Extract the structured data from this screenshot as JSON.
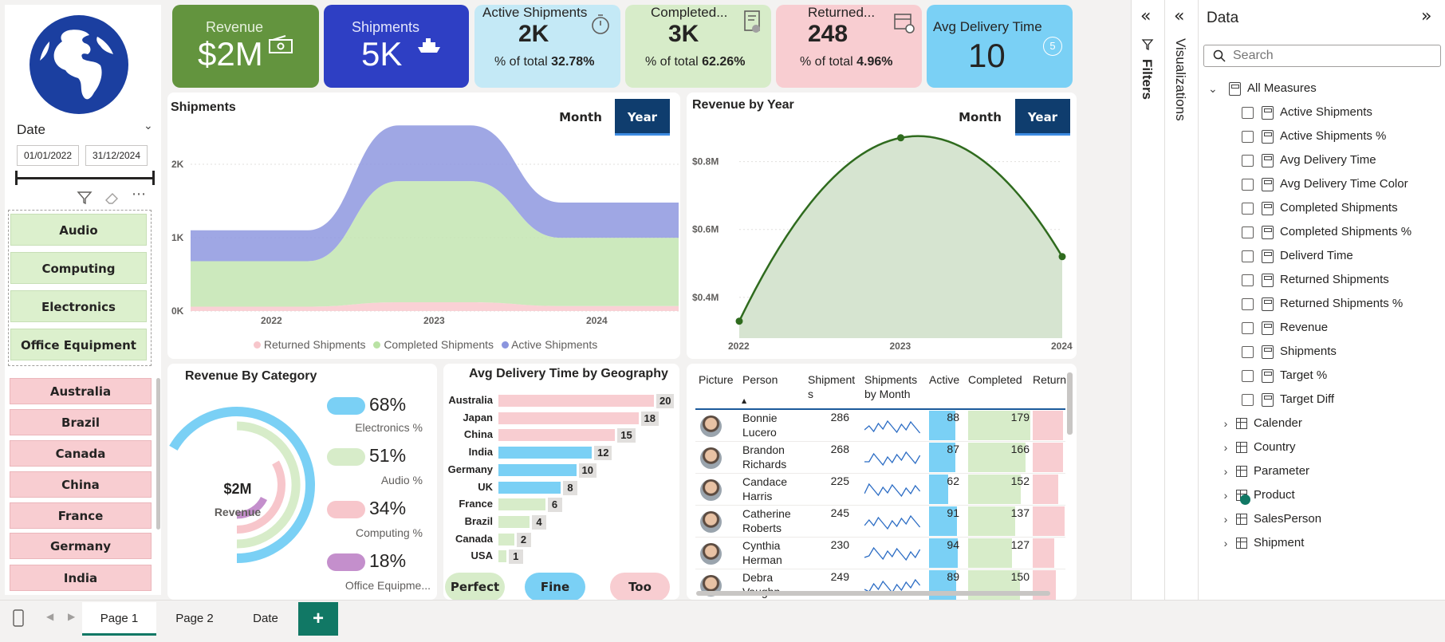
{
  "kpis": {
    "revenue": {
      "label": "Revenue",
      "value": "$2M"
    },
    "shipments": {
      "label": "Shipments",
      "value": "5K"
    },
    "active": {
      "label": "Active Shipments",
      "value": "2K",
      "pct_label": "% of total",
      "pct": "32.78%"
    },
    "completed": {
      "label": "Completed...",
      "value": "3K",
      "pct_label": "% of total",
      "pct": "62.26%"
    },
    "returned": {
      "label": "Returned...",
      "value": "248",
      "pct_label": "% of total",
      "pct": "4.96%"
    },
    "avg_delivery": {
      "label": "Avg Delivery Time",
      "value": "10",
      "badge": "5"
    }
  },
  "slicer": {
    "date_label": "Date",
    "date_from": "01/01/2022",
    "date_to": "31/12/2024",
    "categories": [
      "Audio",
      "Computing",
      "Electronics",
      "Office Equipment"
    ],
    "countries": [
      "Australia",
      "Brazil",
      "Canada",
      "China",
      "France",
      "Germany",
      "India"
    ]
  },
  "shipments_chart": {
    "title": "Shipments",
    "toggle_month": "Month",
    "toggle_year": "Year",
    "legend": [
      "Returned Shipments",
      "Completed Shipments",
      "Active Shipments"
    ]
  },
  "revenue_chart": {
    "title": "Revenue by Year",
    "toggle_month": "Month",
    "toggle_year": "Year"
  },
  "category_chart": {
    "title": "Revenue By Category",
    "center_value": "$2M",
    "center_label": "Revenue",
    "items": [
      {
        "pct": "68%",
        "label": "Electronics %",
        "color": "#7ad0f5"
      },
      {
        "pct": "51%",
        "label": "Audio %",
        "color": "#d7ecc9"
      },
      {
        "pct": "34%",
        "label": "Computing %",
        "color": "#f7c6cb"
      },
      {
        "pct": "18%",
        "label": "Office Equipme...",
        "color": "#c48fcc"
      }
    ]
  },
  "geo_chart": {
    "title": "Avg Delivery Time by Geography",
    "rows": [
      {
        "country": "Australia",
        "value": 20,
        "band": "Too Long"
      },
      {
        "country": "Japan",
        "value": 18,
        "band": "Too Long"
      },
      {
        "country": "China",
        "value": 15,
        "band": "Too Long"
      },
      {
        "country": "India",
        "value": 12,
        "band": "Fine"
      },
      {
        "country": "Germany",
        "value": 10,
        "band": "Fine"
      },
      {
        "country": "UK",
        "value": 8,
        "band": "Fine"
      },
      {
        "country": "France",
        "value": 6,
        "band": "Perfect"
      },
      {
        "country": "Brazil",
        "value": 4,
        "band": "Perfect"
      },
      {
        "country": "Canada",
        "value": 2,
        "band": "Perfect"
      },
      {
        "country": "USA",
        "value": 1,
        "band": "Perfect"
      }
    ],
    "legend": [
      "Perfect",
      "Fine",
      "Too Long"
    ]
  },
  "table": {
    "headers": [
      "Picture",
      "Person",
      "Shipment s",
      "Shipments by Month",
      "Active",
      "Completed",
      "Returne"
    ],
    "rows": [
      {
        "person": "Bonnie Lucero",
        "shipments": "286",
        "active": "88",
        "completed": "179",
        "returned": 0.9
      },
      {
        "person": "Brandon Richards",
        "shipments": "268",
        "active": "87",
        "completed": "166",
        "returned": 0.9
      },
      {
        "person": "Candace Harris",
        "shipments": "225",
        "active": "62",
        "completed": "152",
        "returned": 0.75
      },
      {
        "person": "Catherine Roberts",
        "shipments": "245",
        "active": "91",
        "completed": "137",
        "returned": 0.95
      },
      {
        "person": "Cynthia Herman",
        "shipments": "230",
        "active": "94",
        "completed": "127",
        "returned": 0.65
      },
      {
        "person": "Debra Vaughn",
        "shipments": "249",
        "active": "89",
        "completed": "150",
        "returned": 0.7
      }
    ]
  },
  "panes": {
    "filters_label": "Filters",
    "visualizations_label": "Visualizations",
    "data_title": "Data",
    "search_placeholder": "Search",
    "all_measures": "All Measures",
    "measures": [
      "Active Shipments",
      "Active Shipments %",
      "Avg Delivery Time",
      "Avg Delivery Time Color",
      "Completed Shipments",
      "Completed Shipments %",
      "Deliverd Time",
      "Returned Shipments",
      "Returned Shipments %",
      "Revenue",
      "Shipments",
      "Target %",
      "Target Diff"
    ],
    "tables": [
      "Calender",
      "Country",
      "Parameter",
      "Product",
      "SalesPerson",
      "Shipment"
    ]
  },
  "page_tabs": [
    "Page 1",
    "Page 2",
    "Date"
  ],
  "add_page": "+",
  "chart_data": [
    {
      "type": "area",
      "title": "Shipments",
      "categories": [
        "2022",
        "2023",
        "2024"
      ],
      "series": [
        {
          "name": "Returned Shipments",
          "values": [
            60,
            120,
            68
          ]
        },
        {
          "name": "Completed Shipments",
          "values": [
            620,
            1650,
            930
          ]
        },
        {
          "name": "Active Shipments",
          "values": [
            420,
            760,
            480
          ]
        }
      ],
      "ylim": [
        0,
        2500
      ],
      "yticks": [
        "0K",
        "1K",
        "2K"
      ]
    },
    {
      "type": "area",
      "title": "Revenue by Year",
      "categories": [
        "2022",
        "2023",
        "2024"
      ],
      "series": [
        {
          "values": [
            0.33,
            0.87,
            0.52
          ]
        }
      ],
      "ylim": [
        0.28,
        0.9
      ],
      "yticks": [
        "$0.4M",
        "$0.6M",
        "$0.8M"
      ]
    }
  ]
}
